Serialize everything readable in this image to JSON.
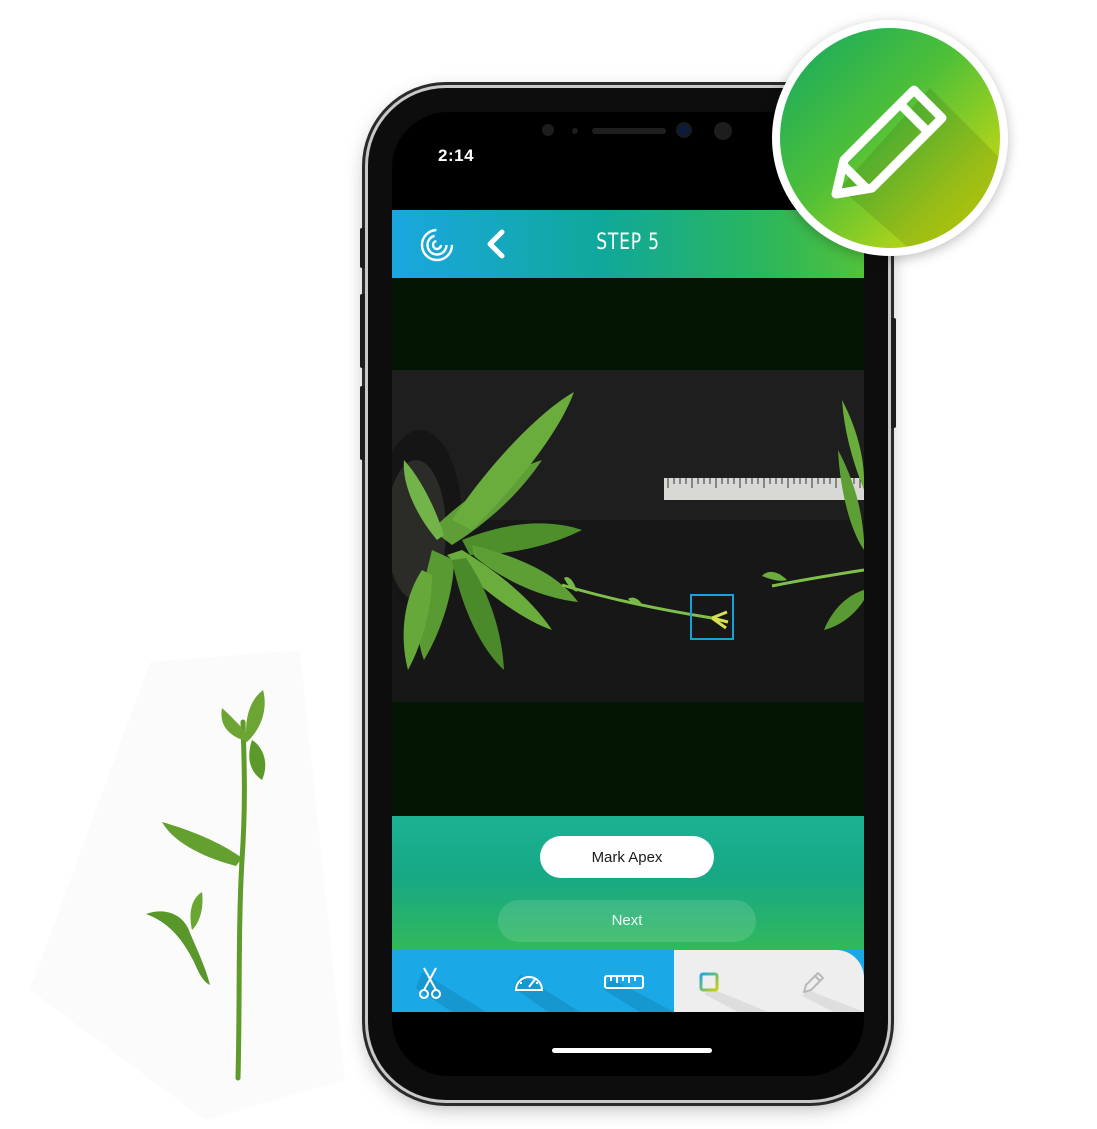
{
  "statusbar": {
    "time": "2:14"
  },
  "header": {
    "title": "STEP 5",
    "logo_icon": "spiral-logo-icon",
    "back_icon": "chevron-left-icon"
  },
  "actions": {
    "mark_label": "Mark Apex",
    "next_label": "Next"
  },
  "toolbar": {
    "items": [
      {
        "icon": "scissors-icon",
        "state": "done"
      },
      {
        "icon": "gauge-icon",
        "state": "done"
      },
      {
        "icon": "ruler-icon",
        "state": "done"
      },
      {
        "icon": "square-select-icon",
        "state": "active"
      },
      {
        "icon": "pencil-icon",
        "state": "inactive"
      }
    ]
  },
  "badge": {
    "icon": "pencil-icon"
  },
  "colors": {
    "brand_blue": "#1aa9e6",
    "brand_teal": "#10a89a",
    "brand_green": "#52c23c",
    "badge_yellow": "#d9dd00",
    "selection_box": "#1aa0d8"
  }
}
